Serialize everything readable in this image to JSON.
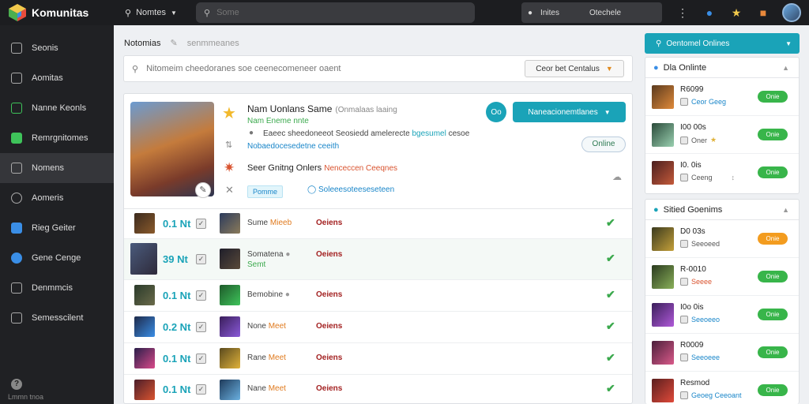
{
  "app": {
    "brand": "Komunitas"
  },
  "topbar": {
    "dropdown_label": "Nomtes",
    "search_placeholder": "Some",
    "control_left": "Inites",
    "control_right": "Otechele"
  },
  "sidebar": {
    "items": [
      {
        "label": "Seonis",
        "icon": "compass-icon"
      },
      {
        "label": "Aomitas",
        "icon": "clipboard-icon"
      },
      {
        "label": "Nanne Keonls",
        "icon": "chart-icon"
      },
      {
        "label": "Remrgnitomes",
        "icon": "game-icon"
      },
      {
        "label": "Nomens",
        "icon": "controller-icon"
      },
      {
        "label": "Aomeris",
        "icon": "trophy-icon"
      },
      {
        "label": "Rieg Geiter",
        "icon": "store-icon"
      },
      {
        "label": "Gene Cenge",
        "icon": "puzzle-icon"
      },
      {
        "label": "Denmmcis",
        "icon": "calendar-icon"
      },
      {
        "label": "Semesscilent",
        "icon": "tools-icon"
      }
    ],
    "active_index": 4,
    "footer": "Lmmn tnoa"
  },
  "main": {
    "breadcrumb": {
      "title": "Notomias",
      "sub": "senmmeanes"
    },
    "search": {
      "placeholder": "Nitomeim cheedoranes soe ceenecomeneer oaent",
      "sort_label": "Ceor bet Centalus"
    },
    "feature": {
      "title": "Nam Uonlans Same",
      "title_sub": "(Onmalaas laaing",
      "green_text": "Nam Eneme nnte",
      "desc": "Eaeec sheedoneeot Seosiedd amelerecte",
      "desc_highlight": "bgesumel",
      "desc_tail": "cesoe",
      "link": "Nobaedocesedetne ceeith",
      "social_label": "Seer Gnitng Onlers",
      "social_red": "Nenceccen Ceeqnes",
      "tag": "Pomme",
      "tag2": "Soleeesoteeseseteen",
      "primary_button": "Naneacionemtlanes",
      "round_button": "Oo",
      "online_button": "Online"
    },
    "rows": [
      {
        "value": "0.1 Nt",
        "name": "Sume",
        "level": "Mieeb",
        "sub": "",
        "status": "Oeiens"
      },
      {
        "value": "39 Nt",
        "name": "Somatena",
        "level": "",
        "sub": "Semt",
        "status": "Oeiens"
      },
      {
        "value": "0.1 Nt",
        "name": "Bemobine",
        "level": "",
        "sub": "",
        "status": "Oeiens"
      },
      {
        "value": "0.2 Nt",
        "name": "None",
        "level": "Meet",
        "sub": "",
        "status": "Oeiens"
      },
      {
        "value": "0.1 Nt",
        "name": "Rane",
        "level": "Meet",
        "sub": "",
        "status": "Oeiens"
      },
      {
        "value": "0.1 Nt",
        "name": "Nane",
        "level": "Meet",
        "sub": "",
        "status": "Oeiens"
      }
    ]
  },
  "right": {
    "header": "Oentomel Onlines",
    "card1": {
      "title": "Dla Onlinte",
      "items": [
        {
          "title": "R6099",
          "sub": "Ceor Geeg",
          "pill": "Onie",
          "pill_color": "green"
        },
        {
          "title": "I00 00s",
          "sub": "Oner",
          "pill": "Onie",
          "pill_color": "green"
        },
        {
          "title": "I0. 0is",
          "sub": "Ceeng",
          "pill": "Onie",
          "pill_color": "green"
        }
      ]
    },
    "card2": {
      "title": "Sitied Goenims",
      "items": [
        {
          "title": "D0 03s",
          "sub": "Seeoeed",
          "pill": "Onie",
          "pill_color": "orange"
        },
        {
          "title": "R-0010",
          "sub": "Seeee",
          "pill": "Onie",
          "pill_color": "green"
        },
        {
          "title": "I0o 0is",
          "sub": "Seeoeeo",
          "pill": "Onie",
          "pill_color": "green"
        },
        {
          "title": "R0009",
          "sub": "Seeoeee",
          "pill": "Onie",
          "pill_color": "green"
        },
        {
          "title": "Resmod",
          "sub": "Geoeg Ceeoant",
          "pill": "Onie",
          "pill_color": "green"
        }
      ]
    }
  },
  "colors": {
    "accent": "#1aa3b8",
    "sidebar_bg": "#202124",
    "topbar_bg": "#1c1d20",
    "status_green": "#38b54a",
    "status_orange": "#f39c1f"
  }
}
